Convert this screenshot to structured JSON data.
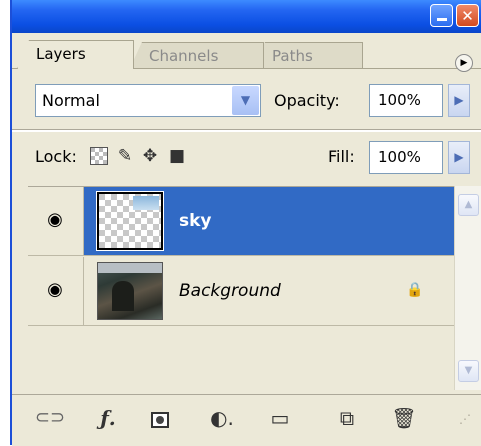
{
  "tabs": [
    {
      "label": "Layers",
      "active": true
    },
    {
      "label": "Channels",
      "active": false
    },
    {
      "label": "Paths",
      "active": false
    }
  ],
  "blend_mode": {
    "value": "Normal"
  },
  "opacity": {
    "label": "Opacity:",
    "value": "100%"
  },
  "lock": {
    "label": "Lock:"
  },
  "fill": {
    "label": "Fill:",
    "value": "100%"
  },
  "layers": [
    {
      "name": "sky",
      "visible": true,
      "selected": true,
      "locked": false
    },
    {
      "name": "Background",
      "visible": true,
      "selected": false,
      "locked": true
    }
  ],
  "icons": {
    "minimize": "minimize-icon",
    "close": "close-icon",
    "panel_menu": "panel-menu-icon",
    "lock_transparent": "lock-transparent-pixels-icon",
    "lock_image": "lock-image-pixels-icon",
    "lock_position": "lock-position-icon",
    "lock_all": "lock-all-icon",
    "eye": "eye-icon",
    "layer_lock": "lock-icon",
    "link": "link-layers-icon",
    "layer_style": "layer-style-icon",
    "mask": "layer-mask-icon",
    "adjustment": "adjustment-layer-icon",
    "group": "folder-icon",
    "new_layer": "new-layer-icon",
    "trash": "trash-icon"
  },
  "colors": {
    "title_bar": "#0b4fe3",
    "selection": "#316ac5",
    "panel_bg": "#ece9d8"
  }
}
